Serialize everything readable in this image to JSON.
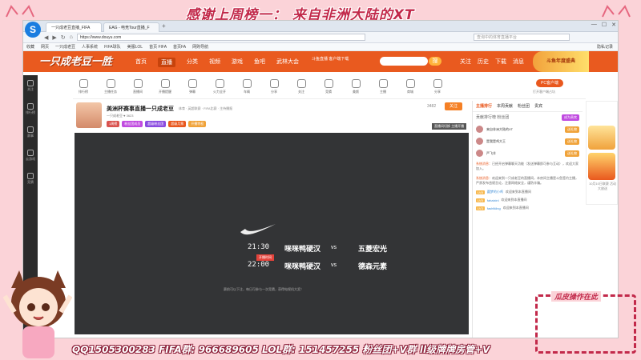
{
  "overlay": {
    "top_banner": "感谢上周榜一： 来自非洲大陆的XT",
    "bottom_banner": "QQ1505300283 FIFA群: 966689605 LOL群: 151457255 粉丝团+V群 ll级牌牌房管+V",
    "op_label": "瓜皮操作在此",
    "colors": {
      "accent": "#c2294a",
      "frame": "#fbd3d8"
    }
  },
  "browser": {
    "tabs": [
      "一只成老豆直播_FIFA",
      "EAG - 电竞Tour直播_F"
    ],
    "new_tab": "+",
    "url": "https://www.douyu.com",
    "search_placeholder": "查询中的体育直播平台",
    "bookmarks": [
      "收藏",
      "网页",
      "一只成老豆",
      "人事系统",
      "FIFA球队",
      "美服LOL",
      "首页 FIFA",
      "首页FA",
      "网购导航"
    ],
    "bookmark_right": "隐私记录"
  },
  "site": {
    "logo": "一只成老豆一胜",
    "nav": [
      "首页",
      "直播",
      "分类",
      "视频",
      "游戏",
      "鱼吧",
      "武林大会"
    ],
    "active_nav": "直播",
    "download": "斗鱼直播 客户端下载",
    "search_btn": "搜",
    "user_items": [
      "关注",
      "历史",
      "下载",
      "消息"
    ],
    "mascot_text": "斗鱼年度盛典"
  },
  "left_rail": [
    "关注",
    "排行榜",
    "赛事",
    "云游戏",
    "竞猜"
  ],
  "toolbar": {
    "items": [
      "排行榜",
      "主播任务",
      "直播间",
      "开播提醒",
      "弹幕",
      "火力全开",
      "车辆",
      "分享",
      "关注",
      "竞猜",
      "美颜",
      "主播",
      "商城",
      "分享"
    ],
    "pc_btn": "PC客户端",
    "pc_sub": "打开客户端占坑"
  },
  "room": {
    "title": "美洲杯赛事直播一只成老豆",
    "tags": "体育 · 英超联赛 · FIFA比赛 · 主持播报",
    "meta": "一只成老豆 ♥ 3623",
    "badges": [
      "1周榜",
      "粉丝团成员",
      "超级粉丝团",
      "超级月票",
      "开播特权"
    ],
    "follow_count": "3482",
    "follow_btn": "关注",
    "stream_label": "直播间切换 主播开播"
  },
  "player": {
    "matches": [
      {
        "time": "21:30",
        "team_a": "咪咪鸭硬汉",
        "vs": "vs",
        "team_b": "五菱宏光"
      },
      {
        "time": "22:00",
        "team_a": "咪咪鸭硬汉",
        "vs": "vs",
        "team_b": "德森元素"
      }
    ],
    "live_tag": "开播时间",
    "notice": "赛前可以下注，每日可参与一次竞猜，获得电视机大奖！"
  },
  "chat": {
    "tabs": [
      "主播排行",
      "本周贡献",
      "粉丝团",
      "贵宾"
    ],
    "rank_header": "贡献排行榜 粉丝团",
    "rank_btn": "成为贵宾",
    "ranks": [
      {
        "name": "来自非洲大陆的XT",
        "gift": "送礼物"
      },
      {
        "name": "是我是鸡大王",
        "gift": "送礼物"
      },
      {
        "name": "严飞羊",
        "gift": "送礼物"
      }
    ],
    "sys_msgs": [
      {
        "tag": "系统消息：",
        "text": "已经开启弹幕聊天功能（发送弹幕即可参与互动），欢迎大家加入。"
      },
      {
        "tag": "系统消息：",
        "text": "欢迎来到一只成老豆的直播间，本房间主播是斗鱼签约主播，严禁发布违规言论，注意网络安全，谨防诈骗。"
      }
    ],
    "lines": [
      {
        "lv": "LV8",
        "name": "圆梦的小鸡",
        "text": "欢迎来到本直播间"
      },
      {
        "lv": "LV5",
        "name": "fahaixinl",
        "text": "欢迎来到本直播间"
      },
      {
        "lv": "LV3",
        "name": "fashfkilng",
        "text": "欢迎来到本直播间"
      }
    ]
  },
  "right_ad": {
    "text": "10月10日联赛 活动大放送"
  }
}
